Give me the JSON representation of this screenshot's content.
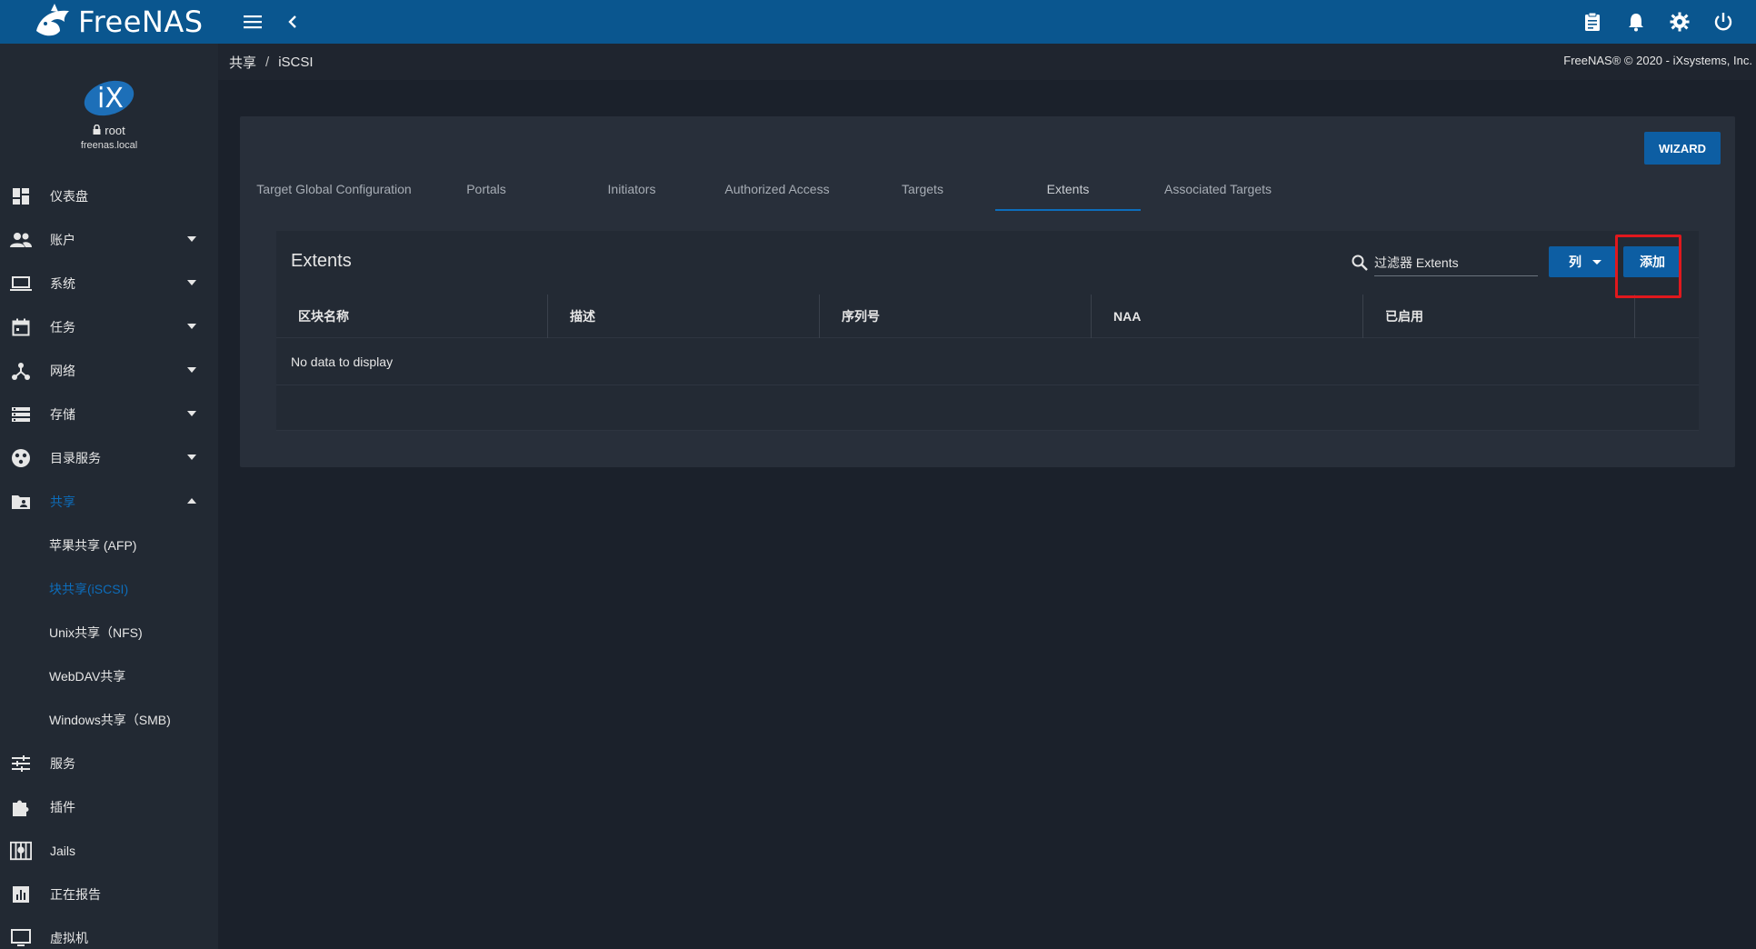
{
  "app": {
    "brand_name": "FreeNAS",
    "copyright": "FreeNAS® © 2020 - iXsystems, Inc."
  },
  "topbar": {
    "icons": [
      "menu-icon",
      "chevron-left-icon",
      "clipboard-icon",
      "bell-icon",
      "gear-icon",
      "power-icon"
    ]
  },
  "user": {
    "name": "root",
    "host": "freenas.local"
  },
  "sidebar": {
    "items": [
      {
        "label": "仪表盘",
        "icon": "dashboard-icon",
        "caret": ""
      },
      {
        "label": "账户",
        "icon": "users-icon",
        "caret": "down"
      },
      {
        "label": "系统",
        "icon": "laptop-icon",
        "caret": "down"
      },
      {
        "label": "任务",
        "icon": "calendar-icon",
        "caret": "down"
      },
      {
        "label": "网络",
        "icon": "network-icon",
        "caret": "down"
      },
      {
        "label": "存储",
        "icon": "storage-icon",
        "caret": "down"
      },
      {
        "label": "目录服务",
        "icon": "directory-icon",
        "caret": "down"
      },
      {
        "label": "共享",
        "icon": "folder-share-icon",
        "caret": "up"
      }
    ],
    "sub_items": [
      {
        "label": "苹果共享 (AFP)"
      },
      {
        "label": "块共享(iSCSI)"
      },
      {
        "label": "Unix共享（NFS)"
      },
      {
        "label": "WebDAV共享"
      },
      {
        "label": "Windows共享（SMB)"
      }
    ],
    "bottom_items": [
      {
        "label": "服务",
        "icon": "sliders-icon"
      },
      {
        "label": "插件",
        "icon": "puzzle-icon"
      },
      {
        "label": "Jails",
        "icon": "jail-icon"
      },
      {
        "label": "正在报告",
        "icon": "report-icon"
      },
      {
        "label": "虚拟机",
        "icon": "vm-icon"
      }
    ]
  },
  "breadcrumb": {
    "items": [
      "共享",
      "iSCSI"
    ],
    "separator": "/"
  },
  "card": {
    "wizard_label": "WIZARD",
    "tabs": [
      {
        "label": "Target Global Configuration"
      },
      {
        "label": "Portals"
      },
      {
        "label": "Initiators"
      },
      {
        "label": "Authorized Access"
      },
      {
        "label": "Targets"
      },
      {
        "label": "Extents"
      },
      {
        "label": "Associated Targets"
      }
    ],
    "active_tab": "Extents"
  },
  "table": {
    "title": "Extents",
    "filter_placeholder": "过滤器 Extents",
    "columns_button": "列",
    "add_button": "添加",
    "columns": [
      "区块名称",
      "描述",
      "序列号",
      "NAA",
      "已启用"
    ],
    "empty_message": "No data to display"
  },
  "colors": {
    "topbar": "#0a568f",
    "sidebar": "#222933",
    "background": "#1b212b",
    "accent": "#0d6dbb",
    "button": "#0d5ea3",
    "highlight": "#e0181d"
  }
}
